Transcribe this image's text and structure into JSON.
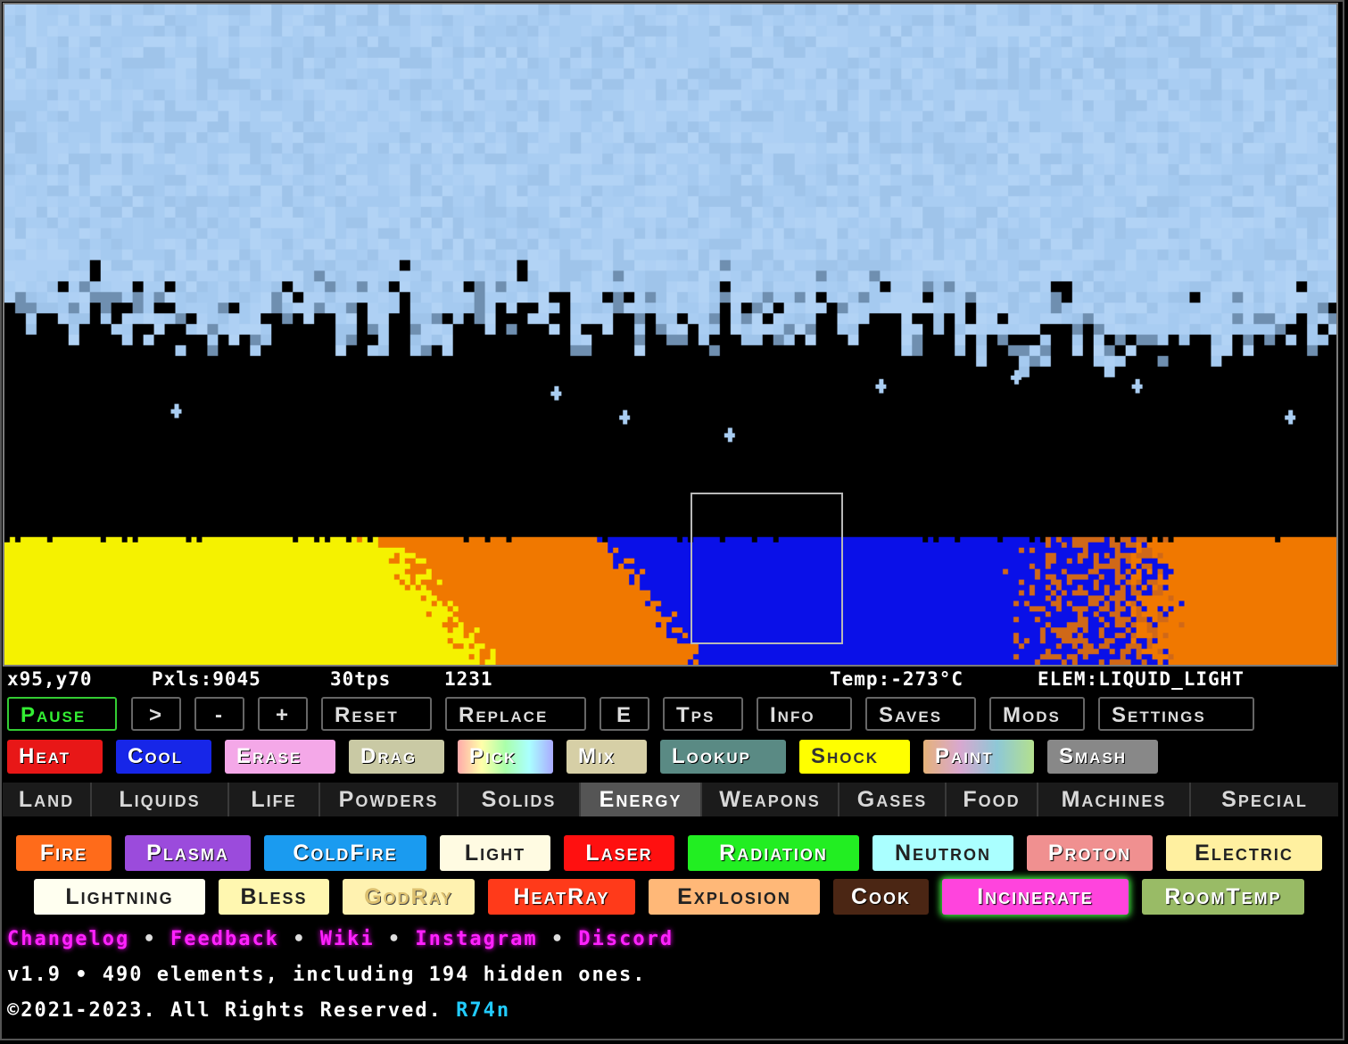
{
  "status": {
    "coords": "x95,y70",
    "pixels": "Pxls:9045",
    "tps": "30tps",
    "ticks": "1231",
    "temp": "Temp:-273°C",
    "element": "ELEM:LIQUID_LIGHT"
  },
  "controls": [
    "Pause",
    ">",
    "-",
    "+",
    "Reset",
    "Replace",
    "E",
    "Tps",
    "Info",
    "Saves",
    "Mods",
    "Settings"
  ],
  "tools": [
    "Heat",
    "Cool",
    "Erase",
    "Drag",
    "Pick",
    "Mix",
    "Lookup",
    "Shock",
    "Paint",
    "Smash"
  ],
  "categories": [
    "Land",
    "Liquids",
    "Life",
    "Powders",
    "Solids",
    "Energy",
    "Weapons",
    "Gases",
    "Food",
    "Machines",
    "Special"
  ],
  "active_category": "Energy",
  "elements": [
    "Fire",
    "Plasma",
    "ColdFire",
    "Light",
    "Laser",
    "Radiation",
    "Neutron",
    "Proton",
    "Electric",
    "Lightning",
    "Bless",
    "GodRay",
    "HeatRay",
    "Explosion",
    "Cook",
    "Incinerate",
    "RoomTemp"
  ],
  "footer": {
    "links": [
      "Changelog",
      "Feedback",
      "Wiki",
      "Instagram",
      "Discord"
    ],
    "separator": "•",
    "version_line": "v1.9 • 490 elements, including 194 hidden ones.",
    "copyright": "©2021-2023. All Rights Reserved.",
    "author": "R74n"
  },
  "colors": {
    "ice": "#a9cdf2",
    "yellow": "#f5f200",
    "orange": "#f07800",
    "blue": "#0a10e8",
    "pause_green": "#33ee33",
    "link_magenta": "#ff22ff",
    "author_cyan": "#22ccff"
  }
}
